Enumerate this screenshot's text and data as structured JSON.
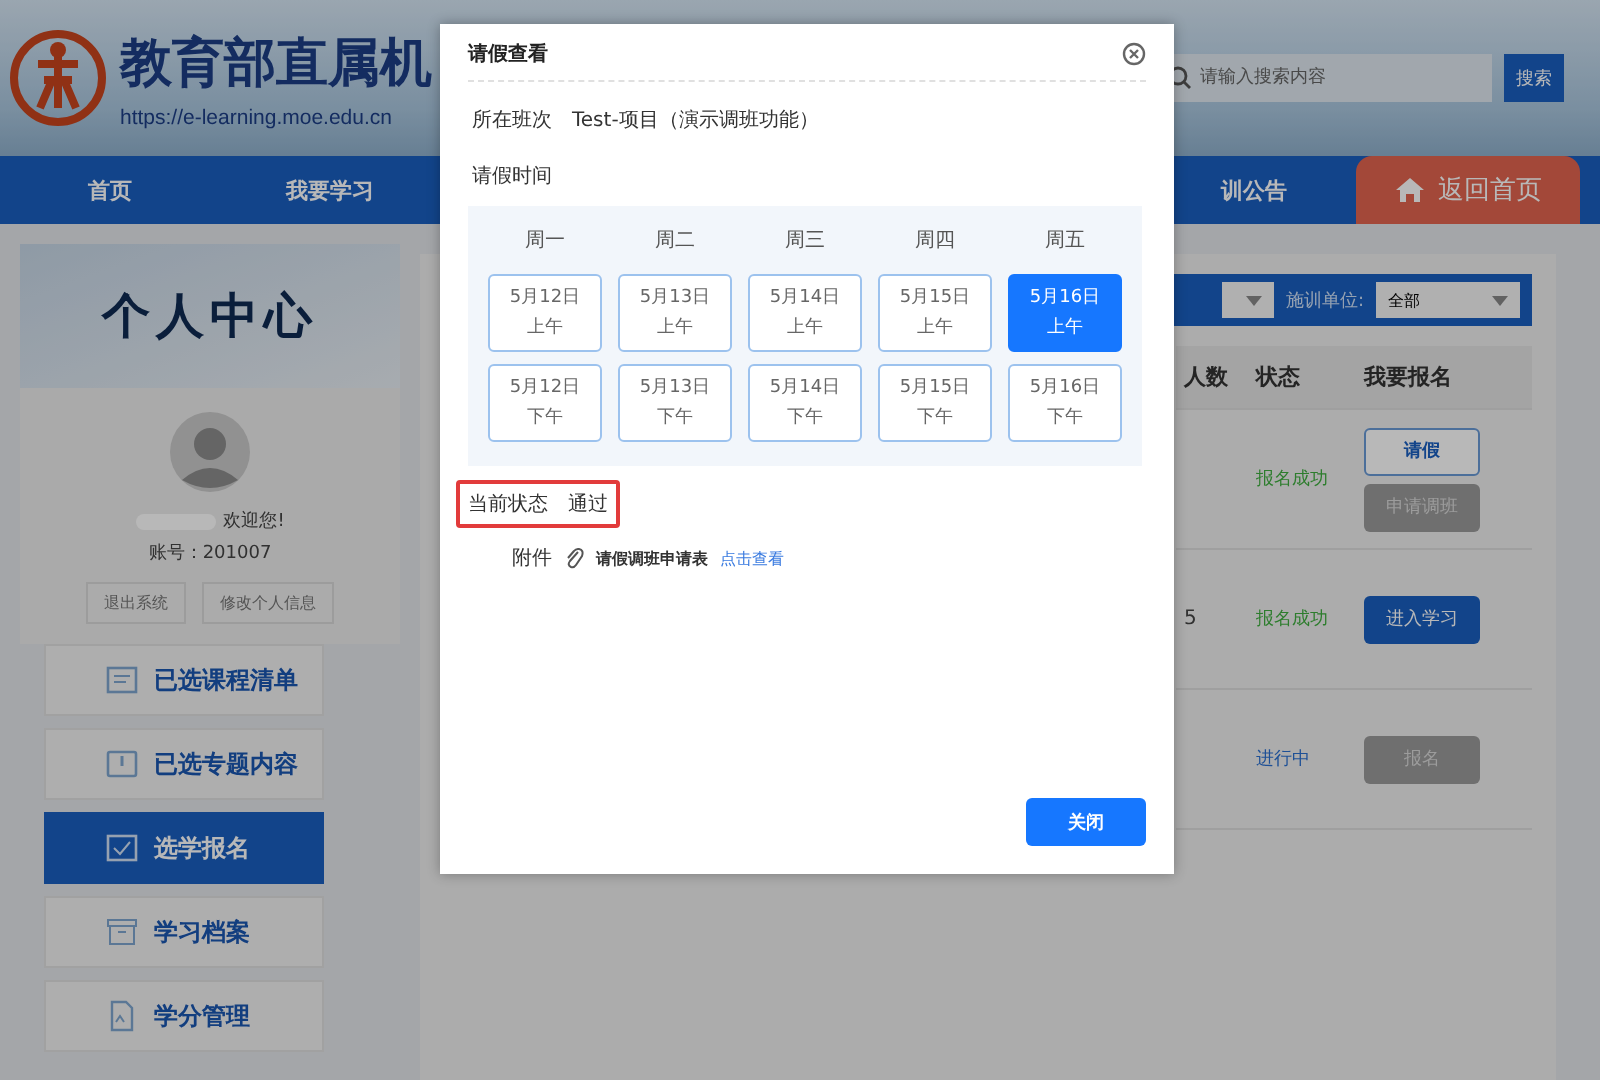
{
  "header": {
    "title": "教育部直属机",
    "url": "https://e-learning.moe.edu.cn",
    "search": {
      "placeholder": "请输入搜索内容"
    },
    "search_button": "搜索"
  },
  "nav": {
    "items": [
      {
        "label": "首页"
      },
      {
        "label": "我要学习"
      },
      {
        "label": "训公告"
      }
    ],
    "home_button": "返回首页"
  },
  "sidebar": {
    "title": "个人中心",
    "greeting": "欢迎您!",
    "account": "账号：201007",
    "buttons": [
      "退出系统",
      "修改个人信息"
    ],
    "items": [
      {
        "label": "已选课程清单",
        "selected": false
      },
      {
        "label": "已选专题内容",
        "selected": false
      },
      {
        "label": "选学报名",
        "selected": true
      },
      {
        "label": "学习档案",
        "selected": false
      },
      {
        "label": "学分管理",
        "selected": false
      }
    ]
  },
  "filter": {
    "label": "施训单位:",
    "value": "全部"
  },
  "table": {
    "columns": [
      "人数",
      "状态",
      "我要报名"
    ],
    "rows": [
      {
        "column_1": "",
        "status": "报名成功",
        "color": "#2d7d2d",
        "actions": [
          {
            "label": "请假",
            "kind": "outline"
          },
          {
            "label": "申请调班",
            "kind": "disabled"
          }
        ]
      },
      {
        "column_1": "5",
        "status": "报名成功",
        "color": "#2d7d2d",
        "actions": [
          {
            "label": "进入学习",
            "kind": "primary"
          }
        ]
      },
      {
        "column_1": "",
        "status": "进行中",
        "color": "#1e5096",
        "actions": [
          {
            "label": "报名",
            "kind": "disabled"
          }
        ]
      }
    ]
  },
  "dialog": {
    "title": "请假查看",
    "class_label": "所在班次",
    "class_value": "Test-项目（演示调班功能）",
    "time_label": "请假时间",
    "weekdays": [
      "周一",
      "周二",
      "周三",
      "周四",
      "周五"
    ],
    "slots": [
      {
        "date": "5月12日",
        "period": "上午",
        "selected": false
      },
      {
        "date": "5月13日",
        "period": "上午",
        "selected": false
      },
      {
        "date": "5月14日",
        "period": "上午",
        "selected": false
      },
      {
        "date": "5月15日",
        "period": "上午",
        "selected": false
      },
      {
        "date": "5月16日",
        "period": "上午",
        "selected": true
      },
      {
        "date": "5月12日",
        "period": "下午",
        "selected": false
      },
      {
        "date": "5月13日",
        "period": "下午",
        "selected": false
      },
      {
        "date": "5月14日",
        "period": "下午",
        "selected": false
      },
      {
        "date": "5月15日",
        "period": "下午",
        "selected": false
      },
      {
        "date": "5月16日",
        "period": "下午",
        "selected": false
      }
    ],
    "status_label": "当前状态",
    "status_value": "通过",
    "status_highlighted": true,
    "attachment_label": "附件",
    "attachment_file": "请假调班申请表",
    "attachment_link": "点击查看",
    "close_button": "关闭"
  }
}
